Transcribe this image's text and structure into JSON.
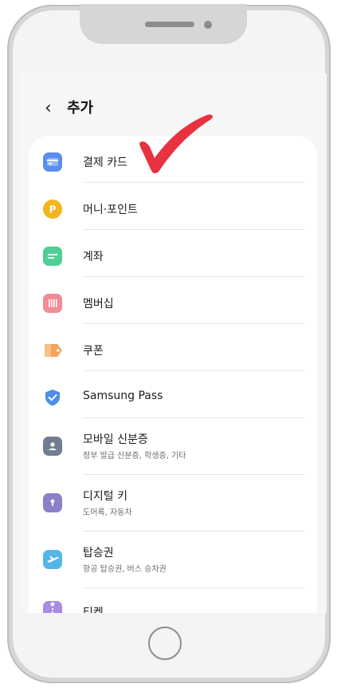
{
  "header": {
    "back_icon": "chevron-left-icon",
    "title": "추가"
  },
  "menu": {
    "items": [
      {
        "label": "결제 카드",
        "sub": "",
        "icon": "card-icon",
        "color": "#5b8ef0"
      },
      {
        "label": "머니·포인트",
        "sub": "",
        "icon": "point-coin-icon",
        "color": "#f3b51d"
      },
      {
        "label": "계좌",
        "sub": "",
        "icon": "account-icon",
        "color": "#4fcf92"
      },
      {
        "label": "멤버십",
        "sub": "",
        "icon": "membership-icon",
        "color": "#f08c96"
      },
      {
        "label": "쿠폰",
        "sub": "",
        "icon": "coupon-icon",
        "color": "#f5a35a"
      },
      {
        "label": "Samsung Pass",
        "sub": "",
        "icon": "shield-check-icon",
        "color": "#4e8eea"
      },
      {
        "label": "모바일 신분증",
        "sub": "정부 발급 신분증, 학생증, 기타",
        "icon": "id-card-icon",
        "color": "#6f7f91"
      },
      {
        "label": "디지털 키",
        "sub": "도어록, 자동차",
        "icon": "digital-key-icon",
        "color": "#8b80c9"
      },
      {
        "label": "탑승권",
        "sub": "항공 탑승권, 버스 승차권",
        "icon": "plane-ticket-icon",
        "color": "#54b6e8"
      },
      {
        "label": "티켓",
        "sub": "",
        "icon": "ticket-icon",
        "color": "#a78be6"
      }
    ]
  },
  "annotation": {
    "type": "checkmark",
    "color": "#e8323f"
  }
}
